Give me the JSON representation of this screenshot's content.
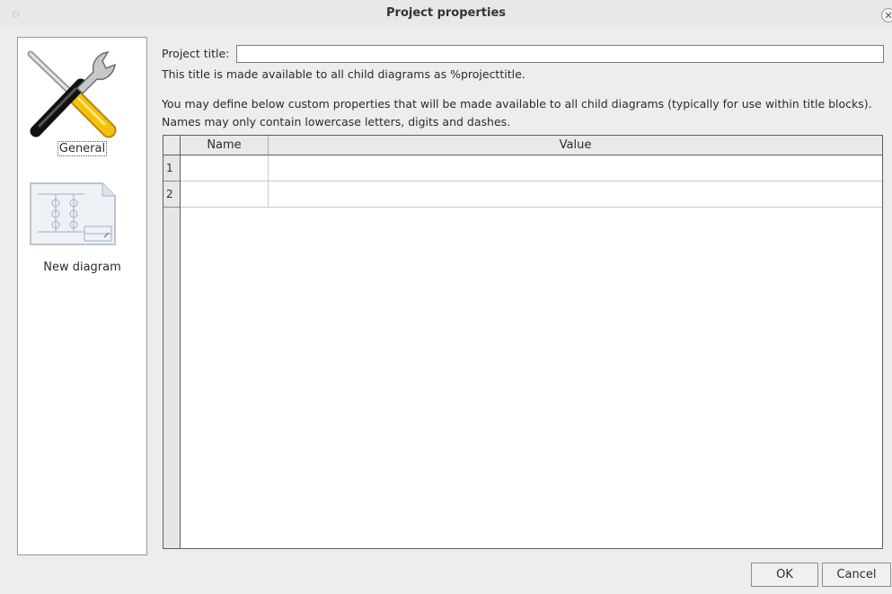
{
  "window": {
    "title": "Project properties"
  },
  "sidebar": {
    "items": [
      {
        "label": "General",
        "selected": true,
        "icon": "tools-icon"
      },
      {
        "label": "New diagram",
        "selected": false,
        "icon": "diagram-icon"
      }
    ]
  },
  "form": {
    "project_title_label": "Project title:",
    "project_title_value": "",
    "help_line1": "This title is made available to all child diagrams as %projecttitle.",
    "help_line2": "You may define below custom properties that will be made available to all child diagrams (typically for use within title blocks).",
    "help_line3": "Names may only contain lowercase letters, digits and dashes."
  },
  "table": {
    "columns": [
      "Name",
      "Value"
    ],
    "rows": [
      {
        "num": "1",
        "name": "",
        "value": ""
      },
      {
        "num": "2",
        "name": "",
        "value": ""
      }
    ]
  },
  "buttons": {
    "ok": "OK",
    "cancel": "Cancel"
  }
}
